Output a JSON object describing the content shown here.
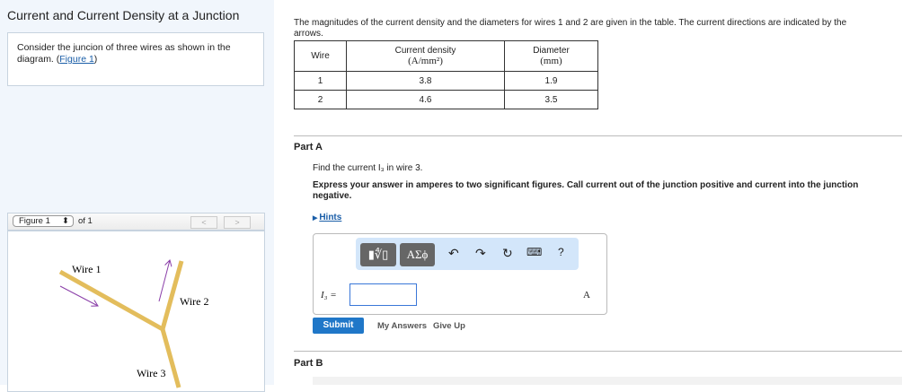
{
  "title": "Current and Current Density at a Junction",
  "intro": {
    "text": "Consider the juncion of three wires as shown in the diagram. (",
    "link": "Figure 1",
    "end": ")"
  },
  "figure": {
    "select": "Figure 1",
    "of": "of 1",
    "prev": "<",
    "next": ">",
    "labels": [
      "Wire 1",
      "Wire 2",
      "Wire 3"
    ],
    "wire_color": "#e3bd5c",
    "arrow_color": "#8a3ea8"
  },
  "description": "The magnitudes of the current density and the diameters for wires 1 and 2 are given in the table. The current directions are indicated by the arrows.",
  "table": {
    "headers": [
      "Wire",
      "Current density",
      "(A/mm²)",
      "Diameter",
      "(mm)"
    ],
    "rows": [
      [
        "1",
        "3.8",
        "1.9"
      ],
      [
        "2",
        "4.6",
        "3.5"
      ]
    ]
  },
  "partA": {
    "title": "Part A",
    "question": "Find the current I₃ in wire 3.",
    "instructions": "Express your answer in amperes to two significant figures. Call current out of the junction positive and current into the junction negative.",
    "hints": "Hints",
    "label": "I₃ =",
    "unit": "A",
    "value": "",
    "toolbar": {
      "templates": "▮∜▯",
      "symbols": "ΑΣϕ",
      "help": "?"
    },
    "submit": "Submit",
    "my_answers": "My Answers",
    "give_up": "Give Up"
  },
  "partB": {
    "title": "Part B"
  }
}
